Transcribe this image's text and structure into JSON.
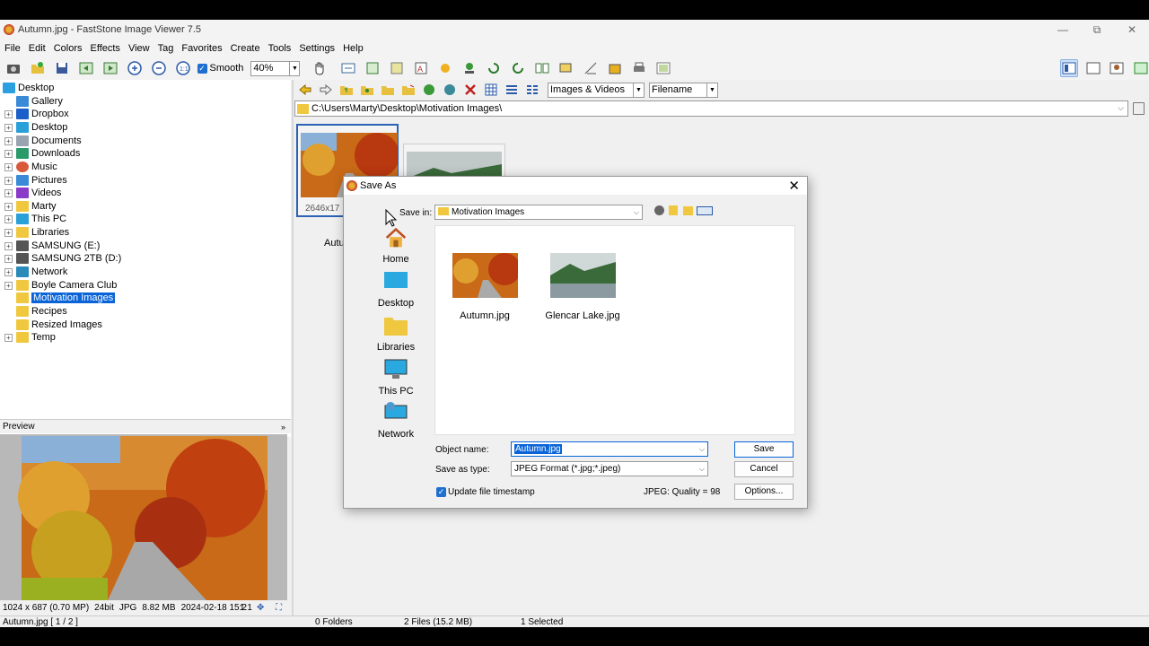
{
  "window": {
    "title": "Autumn.jpg  -  FastStone Image Viewer 7.5",
    "minimize": "—",
    "maximize": "⧉",
    "close": "✕"
  },
  "menu": [
    "File",
    "Edit",
    "Colors",
    "Effects",
    "View",
    "Tag",
    "Favorites",
    "Create",
    "Tools",
    "Settings",
    "Help"
  ],
  "toolbar": {
    "smooth_label": "Smooth",
    "zoom_value": "40%"
  },
  "tree": {
    "items": [
      {
        "label": "Desktop",
        "icon": "desktop-icon"
      },
      {
        "label": "Gallery",
        "icon": "gallery-icon"
      },
      {
        "label": "Dropbox",
        "icon": "dropbox-icon"
      },
      {
        "label": "Desktop",
        "icon": "desktop-icon"
      },
      {
        "label": "Documents",
        "icon": "documents-icon"
      },
      {
        "label": "Downloads",
        "icon": "downloads-icon"
      },
      {
        "label": "Music",
        "icon": "music-icon"
      },
      {
        "label": "Pictures",
        "icon": "pictures-icon"
      },
      {
        "label": "Videos",
        "icon": "videos-icon"
      },
      {
        "label": "Marty",
        "icon": "folder-icon"
      },
      {
        "label": "Libraries",
        "icon": "folder-icon"
      },
      {
        "label": "This PC",
        "icon": "computer-icon"
      },
      {
        "label": "SAMSUNG (E:)",
        "icon": "drive-icon"
      },
      {
        "label": "SAMSUNG 2TB (D:)",
        "icon": "drive-icon"
      },
      {
        "label": "Network",
        "icon": "network-icon"
      },
      {
        "label": "Boyle Camera Club",
        "icon": "folder-icon"
      },
      {
        "label": "Motivation Images",
        "icon": "folder-icon"
      },
      {
        "label": "Recipes",
        "icon": "folder-icon"
      },
      {
        "label": "Resized Images",
        "icon": "folder-icon"
      },
      {
        "label": "Temp",
        "icon": "folder-icon"
      }
    ]
  },
  "preview": {
    "header": "Preview",
    "dimensions": "1024 x 687 (0.70 MP)",
    "bitdepth": "24bit",
    "format": "JPG",
    "filesize": "8.82 MB",
    "date": "2024-02-18 15:2",
    "ratio": "1:1"
  },
  "nav": {
    "filter": "Images & Videos",
    "sort": "Filename"
  },
  "path": "C:\\Users\\Marty\\Desktop\\Motivation Images\\",
  "thumbs": [
    {
      "caption_dim": "2646x17",
      "name": "Autu"
    },
    {
      "caption_dim": "",
      "name": ""
    }
  ],
  "dialog": {
    "title": "Save As",
    "save_in_label": "Save in:",
    "save_in_value": "Motivation Images",
    "places": [
      "Home",
      "Desktop",
      "Libraries",
      "This PC",
      "Network"
    ],
    "files": [
      "Autumn.jpg",
      "Glencar Lake.jpg"
    ],
    "object_name_label": "Object name:",
    "object_name_value": "Autumn.jpg",
    "save_type_label": "Save as type:",
    "save_type_value": "JPEG Format (*.jpg;*.jpeg)",
    "timestamp_label": "Update file timestamp",
    "quality": "JPEG: Quality = 98",
    "save_btn": "Save",
    "cancel_btn": "Cancel",
    "options_btn": "Options..."
  },
  "status": {
    "file": "Autumn.jpg [ 1 / 2 ]",
    "folders": "0 Folders",
    "files": "2 Files (15.2 MB)",
    "selected": "1 Selected"
  }
}
